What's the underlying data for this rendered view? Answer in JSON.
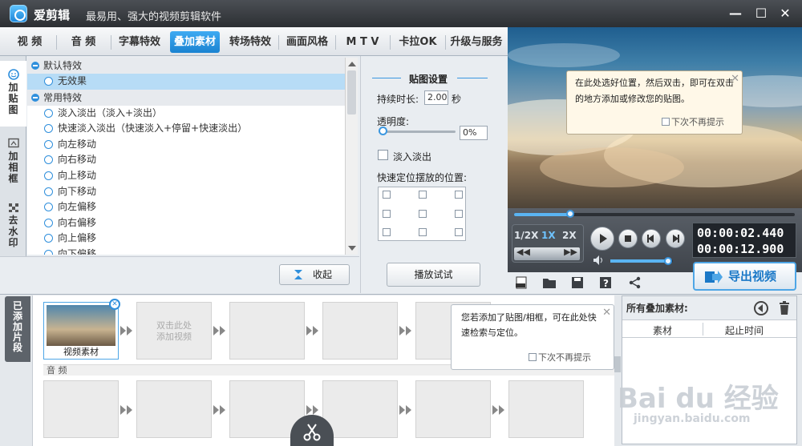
{
  "app": {
    "title": "爱剪辑",
    "slogan": "最易用、强大的视频剪辑软件",
    "controls": {
      "minimize": "—",
      "maximize": "☐",
      "close": "✕"
    }
  },
  "tabs": [
    "视 频",
    "音 频",
    "字幕特效",
    "叠加素材",
    "转场特效",
    "画面风格",
    "M T V",
    "卡拉OK",
    "升级与服务"
  ],
  "active_tab": "叠加素材",
  "side_tabs": [
    "加贴图",
    "加相框",
    "去水印"
  ],
  "effects": {
    "group_default": "默认特效",
    "no_effect": "无效果",
    "group_common": "常用特效",
    "items": [
      "淡入淡出（淡入+淡出）",
      "快速淡入淡出（快速淡入+停留+快速淡出）",
      "向左移动",
      "向右移动",
      "向上移动",
      "向下移动",
      "向左偏移",
      "向右偏移",
      "向上偏移",
      "向下偏移"
    ]
  },
  "collapse_button": "收起",
  "settings": {
    "title": "贴图设置",
    "duration_label": "持续时长:",
    "duration_value": "2.00",
    "duration_unit": "秒",
    "opacity_label": "透明度:",
    "opacity_value": "0%",
    "fade_label": "淡入淡出",
    "position_label": "快速定位摆放的位置:",
    "play_button": "播放试试"
  },
  "preview_tip": {
    "text": "在此处选好位置，然后双击，即可在双击的地方添加或修改您的贴图。",
    "no_remind": "下次不再提示",
    "close": "✕"
  },
  "player": {
    "speeds": [
      "1/2X",
      "1X",
      "2X"
    ],
    "active_speed": "1X",
    "current_time": "00:00:02.440",
    "total_time": "00:00:12.900",
    "seek_fraction": 0.2,
    "volume_fraction": 0.92
  },
  "export_button": "导出视频",
  "timeline": {
    "tab_label": "已添加片段",
    "clip_label": "视频素材",
    "add_video_hint": "双击此处添加视频",
    "audio_label": "音 频"
  },
  "timeline_tip": {
    "text": "您若添加了贴图/相框，可在此处快速检索与定位。",
    "no_remind": "下次不再提示",
    "close": "✕"
  },
  "overlay_panel": {
    "title": "所有叠加素材:",
    "col_material": "素材",
    "col_start": "起止时间"
  },
  "watermark": {
    "logo": "Bai du 经验",
    "url": "jingyan.baidu.com"
  },
  "colors": {
    "accent": "#1a83d1",
    "tab_active": "#2f97e3"
  }
}
